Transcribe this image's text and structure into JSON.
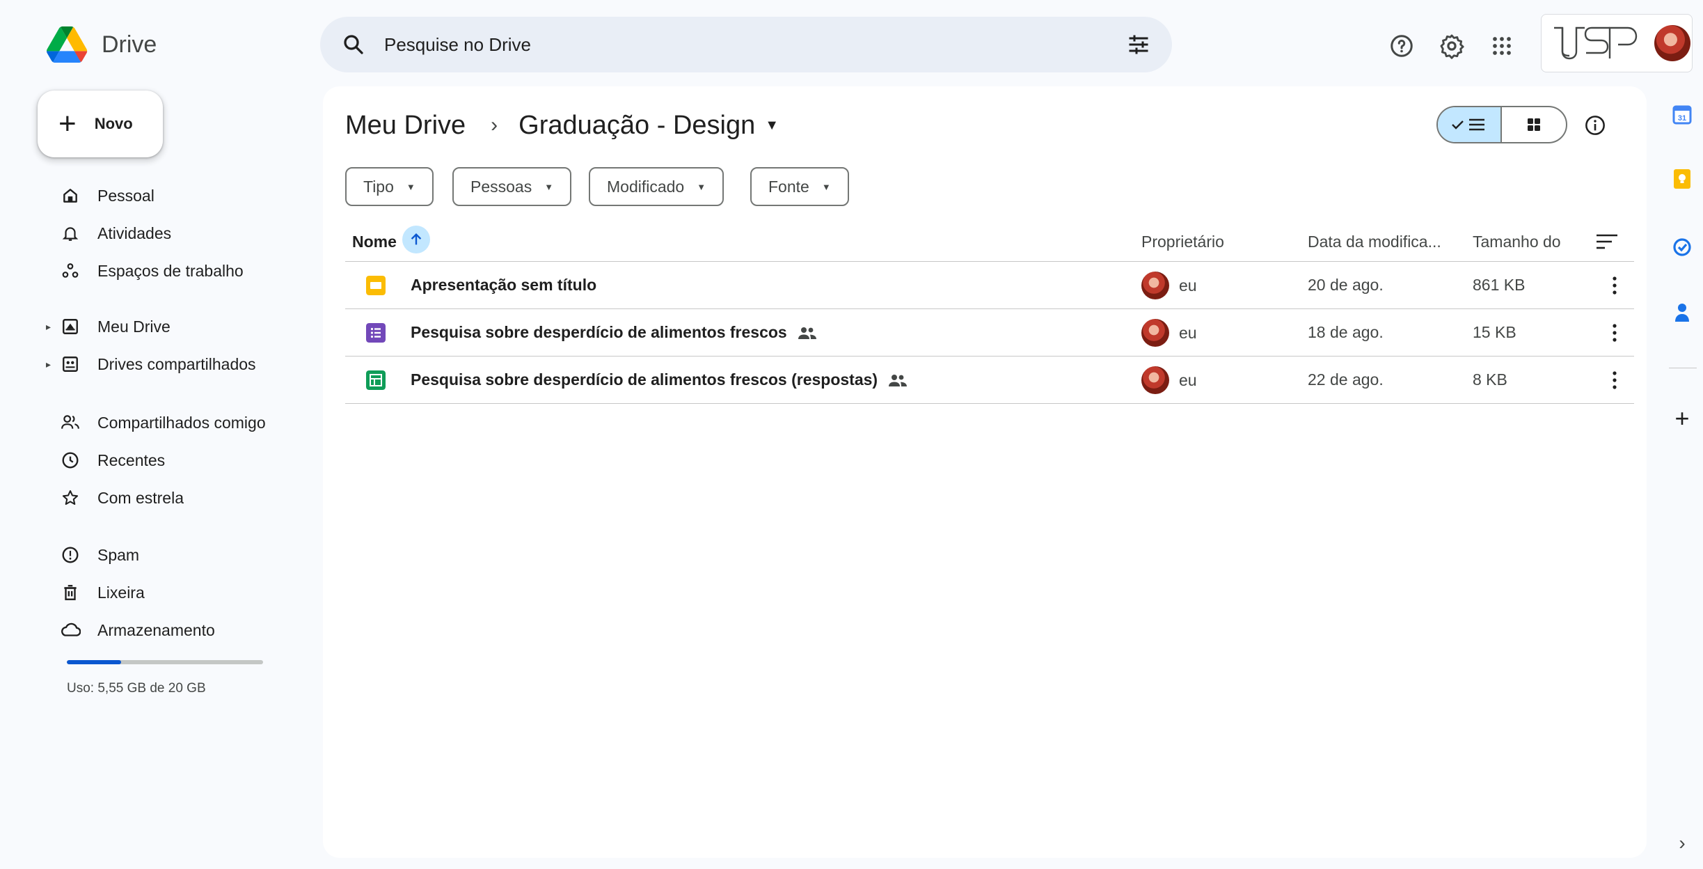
{
  "app": {
    "name": "Drive"
  },
  "search": {
    "placeholder": "Pesquise no Drive"
  },
  "header": {
    "org_logo_text": "USP"
  },
  "sidebar": {
    "new_label": "Novo",
    "items": [
      {
        "label": "Pessoal",
        "icon": "home-icon"
      },
      {
        "label": "Atividades",
        "icon": "bell-icon"
      },
      {
        "label": "Espaços de trabalho",
        "icon": "workspaces-icon"
      },
      {
        "label": "Meu Drive",
        "icon": "my-drive-icon"
      },
      {
        "label": "Drives compartilhados",
        "icon": "shared-drives-icon"
      },
      {
        "label": "Compartilhados comigo",
        "icon": "shared-with-me-icon"
      },
      {
        "label": "Recentes",
        "icon": "clock-icon"
      },
      {
        "label": "Com estrela",
        "icon": "star-icon"
      },
      {
        "label": "Spam",
        "icon": "spam-icon"
      },
      {
        "label": "Lixeira",
        "icon": "trash-icon"
      },
      {
        "label": "Armazenamento",
        "icon": "cloud-icon"
      }
    ],
    "storage": {
      "text": "Uso: 5,55 GB de 20 GB",
      "used_fraction": 0.2775
    }
  },
  "breadcrumb": {
    "root": "Meu Drive",
    "separator": "›",
    "current": "Graduação - Design"
  },
  "filters": [
    "Tipo",
    "Pessoas",
    "Modificado",
    "Fonte"
  ],
  "table": {
    "columns": {
      "name": "Nome",
      "owner": "Proprietário",
      "modified": "Data da modifica...",
      "size": "Tamanho do"
    },
    "rows": [
      {
        "name": "Apresentação sem título",
        "type": "slides",
        "shared": false,
        "owner": "eu",
        "modified": "20 de ago.",
        "size": "861 KB"
      },
      {
        "name": "Pesquisa sobre desperdício de alimentos frescos",
        "type": "forms",
        "shared": true,
        "owner": "eu",
        "modified": "18 de ago.",
        "size": "15 KB"
      },
      {
        "name": "Pesquisa sobre desperdício de alimentos frescos (respostas)",
        "type": "sheets",
        "shared": true,
        "owner": "eu",
        "modified": "22 de ago.",
        "size": "8 KB"
      }
    ]
  },
  "colors": {
    "accent": "#0b57d0",
    "selected": "#c2e7ff",
    "slides": "#fbbc04",
    "forms": "#7248b9",
    "sheets": "#0f9d58"
  }
}
